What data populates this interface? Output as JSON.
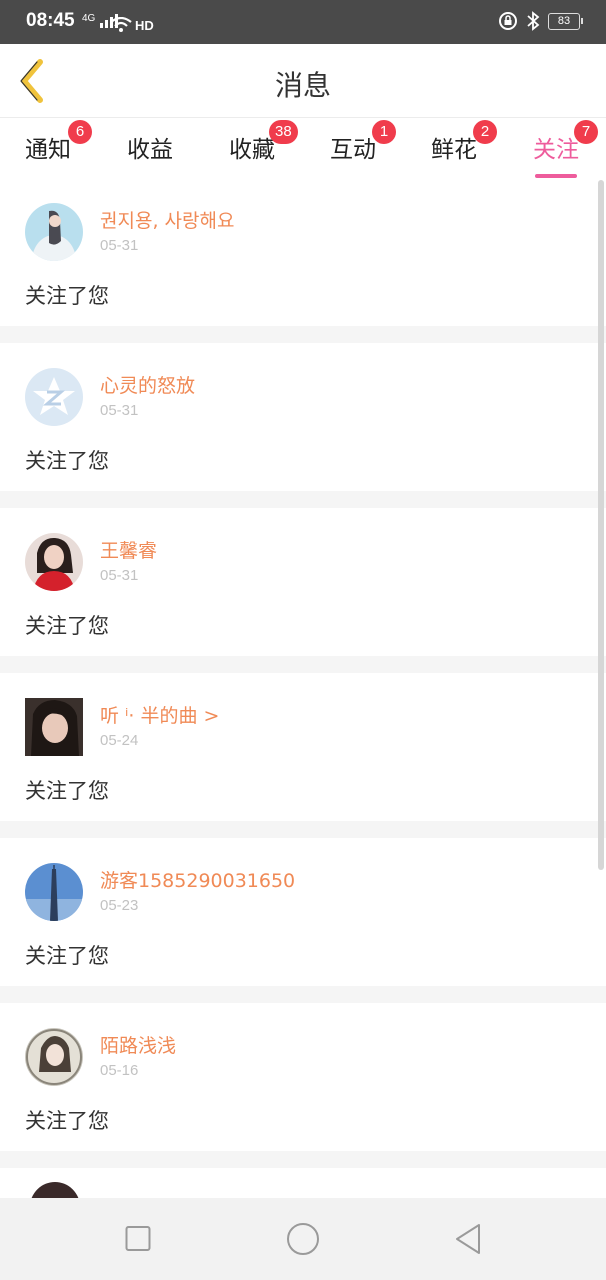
{
  "status_bar": {
    "time": "08:45",
    "signal": "4G",
    "hd": "HD",
    "battery": "83"
  },
  "header": {
    "title": "消息",
    "back_icon": "chevron-left-icon",
    "accent_color": "#ee5c9c",
    "back_color": "#f0c33c"
  },
  "tabs": [
    {
      "label": "通知",
      "badge": "6"
    },
    {
      "label": "收益",
      "badge": ""
    },
    {
      "label": "收藏",
      "badge": "38"
    },
    {
      "label": "互动",
      "badge": "1"
    },
    {
      "label": "鲜花",
      "badge": "2"
    },
    {
      "label": "关注",
      "badge": "7",
      "active": true
    }
  ],
  "items": [
    {
      "name": "권지용, 사랑해요",
      "date": "05-31",
      "message": "关注了您"
    },
    {
      "name": "心灵的怒放",
      "date": "05-31",
      "message": "关注了您"
    },
    {
      "name": "王馨睿",
      "date": "05-31",
      "message": "关注了您"
    },
    {
      "name": "听 ⁱ· 半的曲 >",
      "date": "05-24",
      "message": "关注了您"
    },
    {
      "name": "游客1585290031650",
      "date": "05-23",
      "message": "关注了您"
    },
    {
      "name": "陌路浅浅",
      "date": "05-16",
      "message": "关注了您"
    }
  ],
  "system_nav": {
    "recent_icon": "square-icon",
    "home_icon": "circle-icon",
    "back_icon": "triangle-back-icon"
  }
}
